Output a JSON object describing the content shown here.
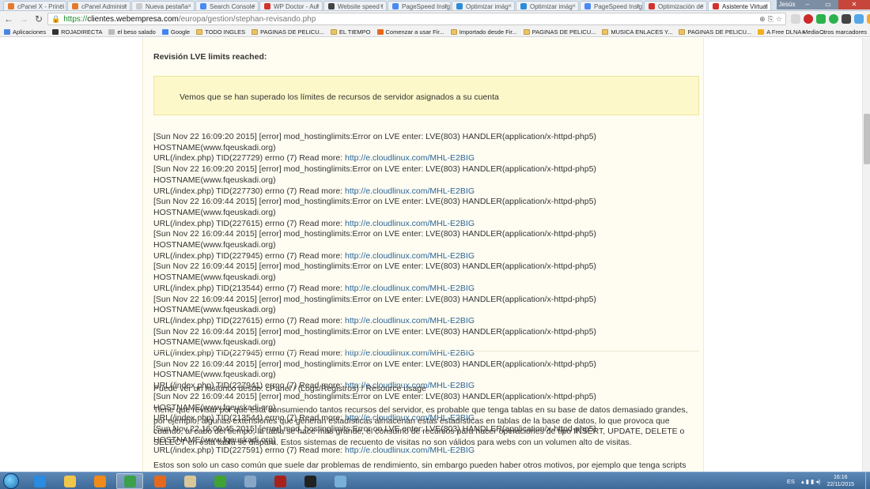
{
  "browser": {
    "tabs": [
      {
        "label": "cPanel X - Princi",
        "color": "#e47a2e"
      },
      {
        "label": "cPanel Administ",
        "color": "#e47a2e"
      },
      {
        "label": "Nueva pestaña",
        "color": "#cccccc"
      },
      {
        "label": "Search Console",
        "color": "#4a8af4"
      },
      {
        "label": "WP Doctor - Aul",
        "color": "#d4322c"
      },
      {
        "label": "Website speed t",
        "color": "#444444"
      },
      {
        "label": "PageSpeed Insig",
        "color": "#4a8af4"
      },
      {
        "label": "Optimizar imág",
        "color": "#2e8bd8"
      },
      {
        "label": "Optimizar imág",
        "color": "#2e8bd8"
      },
      {
        "label": "PageSpeed Insig",
        "color": "#4a8af4"
      },
      {
        "label": "Optimización de",
        "color": "#d4322c"
      },
      {
        "label": "Asistente Virtual",
        "color": "#d4322c",
        "active": true
      }
    ],
    "window_user": "Jesús",
    "url": {
      "scheme": "https://",
      "host": "clientes.webempresa.com",
      "path": "/europa/gestion/stephan-revisando.php"
    },
    "bookmarks": [
      {
        "label": "Aplicaciones",
        "icon": "apps-icon"
      },
      {
        "label": "ROJADIRECTA",
        "icon": "rojadirecta-icon"
      },
      {
        "label": "el beso salado",
        "icon": "page-icon"
      },
      {
        "label": "Google",
        "icon": "google-icon"
      },
      {
        "label": "TODO INGLES",
        "icon": "folder-icon"
      },
      {
        "label": "PAGINAS DE PELICU...",
        "icon": "folder-icon"
      },
      {
        "label": "EL TIEMPO",
        "icon": "folder-icon"
      },
      {
        "label": "Comenzar a usar Fir...",
        "icon": "firefox-icon"
      },
      {
        "label": "Importado desde Fir...",
        "icon": "folder-icon"
      },
      {
        "label": "PAGINAS DE PELICU...",
        "icon": "folder-icon"
      },
      {
        "label": "MUSICA ENLACES Y...",
        "icon": "folder-icon"
      },
      {
        "label": "PAGINAS DE PELICU...",
        "icon": "folder-icon"
      },
      {
        "label": "A Free DLNA Media ...",
        "icon": "dlna-icon"
      }
    ],
    "bookmarks_more": "»",
    "bookmarks_other": "Otros marcadores"
  },
  "page": {
    "section_title": "Revisión LVE limits reached:",
    "alert_text": "Vemos que se han superado los límites de recursos de servidor asignados a su cuenta",
    "log_entries": [
      {
        "line1": "[Sun Nov 22 16:09:20 2015] [error] mod_hostinglimits:Error on LVE enter: LVE(803) HANDLER(application/x-httpd-php5) HOSTNAME(www.fqeuskadi.org)",
        "line2": "URL(/index.php) TID(227729) errno (7) Read more: ",
        "link": "http://e.cloudlinux.com/MHL-E2BIG"
      },
      {
        "line1": "[Sun Nov 22 16:09:20 2015] [error] mod_hostinglimits:Error on LVE enter: LVE(803) HANDLER(application/x-httpd-php5) HOSTNAME(www.fqeuskadi.org)",
        "line2": "URL(/index.php) TID(227730) errno (7) Read more: ",
        "link": "http://e.cloudlinux.com/MHL-E2BIG"
      },
      {
        "line1": "[Sun Nov 22 16:09:44 2015] [error] mod_hostinglimits:Error on LVE enter: LVE(803) HANDLER(application/x-httpd-php5) HOSTNAME(www.fqeuskadi.org)",
        "line2": "URL(/index.php) TID(227615) errno (7) Read more: ",
        "link": "http://e.cloudlinux.com/MHL-E2BIG"
      },
      {
        "line1": "[Sun Nov 22 16:09:44 2015] [error] mod_hostinglimits:Error on LVE enter: LVE(803) HANDLER(application/x-httpd-php5) HOSTNAME(www.fqeuskadi.org)",
        "line2": "URL(/index.php) TID(227945) errno (7) Read more: ",
        "link": "http://e.cloudlinux.com/MHL-E2BIG"
      },
      {
        "line1": "[Sun Nov 22 16:09:44 2015] [error] mod_hostinglimits:Error on LVE enter: LVE(803) HANDLER(application/x-httpd-php5) HOSTNAME(www.fqeuskadi.org)",
        "line2": "URL(/index.php) TID(213544) errno (7) Read more: ",
        "link": "http://e.cloudlinux.com/MHL-E2BIG"
      },
      {
        "line1": "[Sun Nov 22 16:09:44 2015] [error] mod_hostinglimits:Error on LVE enter: LVE(803) HANDLER(application/x-httpd-php5) HOSTNAME(www.fqeuskadi.org)",
        "line2": "URL(/index.php) TID(227615) errno (7) Read more: ",
        "link": "http://e.cloudlinux.com/MHL-E2BIG"
      },
      {
        "line1": "[Sun Nov 22 16:09:44 2015] [error] mod_hostinglimits:Error on LVE enter: LVE(803) HANDLER(application/x-httpd-php5) HOSTNAME(www.fqeuskadi.org)",
        "line2": "URL(/index.php) TID(227945) errno (7) Read more: ",
        "link": "http://e.cloudlinux.com/MHL-E2BIG"
      },
      {
        "line1": "[Sun Nov 22 16:09:44 2015] [error] mod_hostinglimits:Error on LVE enter: LVE(803) HANDLER(application/x-httpd-php5) HOSTNAME(www.fqeuskadi.org)",
        "line2": "URL(/index.php) TID(227941) errno (7) Read more: ",
        "link": "http://e.cloudlinux.com/MHL-E2BIG"
      },
      {
        "line1": "[Sun Nov 22 16:09:44 2015] [error] mod_hostinglimits:Error on LVE enter: LVE(803) HANDLER(application/x-httpd-php5) HOSTNAME(www.fqeuskadi.org)",
        "line2": "URL(/index.php) TID(213544) errno (7) Read more: ",
        "link": "http://e.cloudlinux.com/MHL-E2BIG"
      },
      {
        "line1": "[Sun Nov 22 16:09:45 2015] [error] mod_hostinglimits:Error on LVE enter: LVE(803) HANDLER(application/x-httpd-php5) HOSTNAME(www.fqeuskadi.org)",
        "line2": "URL(/index.php) TID(227591) errno (7) Read more: ",
        "link": "http://e.cloudlinux.com/MHL-E2BIG"
      }
    ],
    "history_text": "Puede ver un histórico desde: cPanel / (Logs/Registros) / Resource usage",
    "explanation_text": "Tiene que revisar por que está consumiendo tantos recursos del servidor, es probable que tenga tablas en su base de datos demasiado grandes, por ejemplo, algunas extensiones que generan estadísticas almacenan estas estadísticas en tablas de la base de datos, lo que provoca que cuando, al cabo del tiempo, la tabla se hace más grande, el consumo de recursos para hacer operaciones de tipo INSERT, UPDATE, DELETE o SELECT en esta tabla se dispara. Estos sistemas de recuento de visitas no son válidos para webs con un volumen alto de visitas.",
    "closing_text": "Estos son solo un caso común que suele dar problemas de rendimiento, sin embargo pueden haber otros motivos, por ejemplo que tenga scripts con"
  },
  "taskbar": {
    "apps": [
      {
        "name": "internet-explorer-icon",
        "color": "#2a8be0"
      },
      {
        "name": "file-explorer-icon",
        "color": "#f0c64a"
      },
      {
        "name": "media-player-icon",
        "color": "#f08a1a"
      },
      {
        "name": "chrome-icon",
        "color": "#3aa04a",
        "active": true
      },
      {
        "name": "firefox-icon",
        "color": "#e5691d"
      },
      {
        "name": "mail-icon",
        "color": "#d9c79a"
      },
      {
        "name": "utorrent-icon",
        "color": "#3fa233"
      },
      {
        "name": "notepad-icon",
        "color": "#88a7c8"
      },
      {
        "name": "app-red-icon",
        "color": "#a8221c"
      },
      {
        "name": "soccer-icon",
        "color": "#222222"
      },
      {
        "name": "network-app-icon",
        "color": "#79b0d9"
      }
    ],
    "language": "ES",
    "time": "16:16",
    "date": "22/11/2015"
  }
}
